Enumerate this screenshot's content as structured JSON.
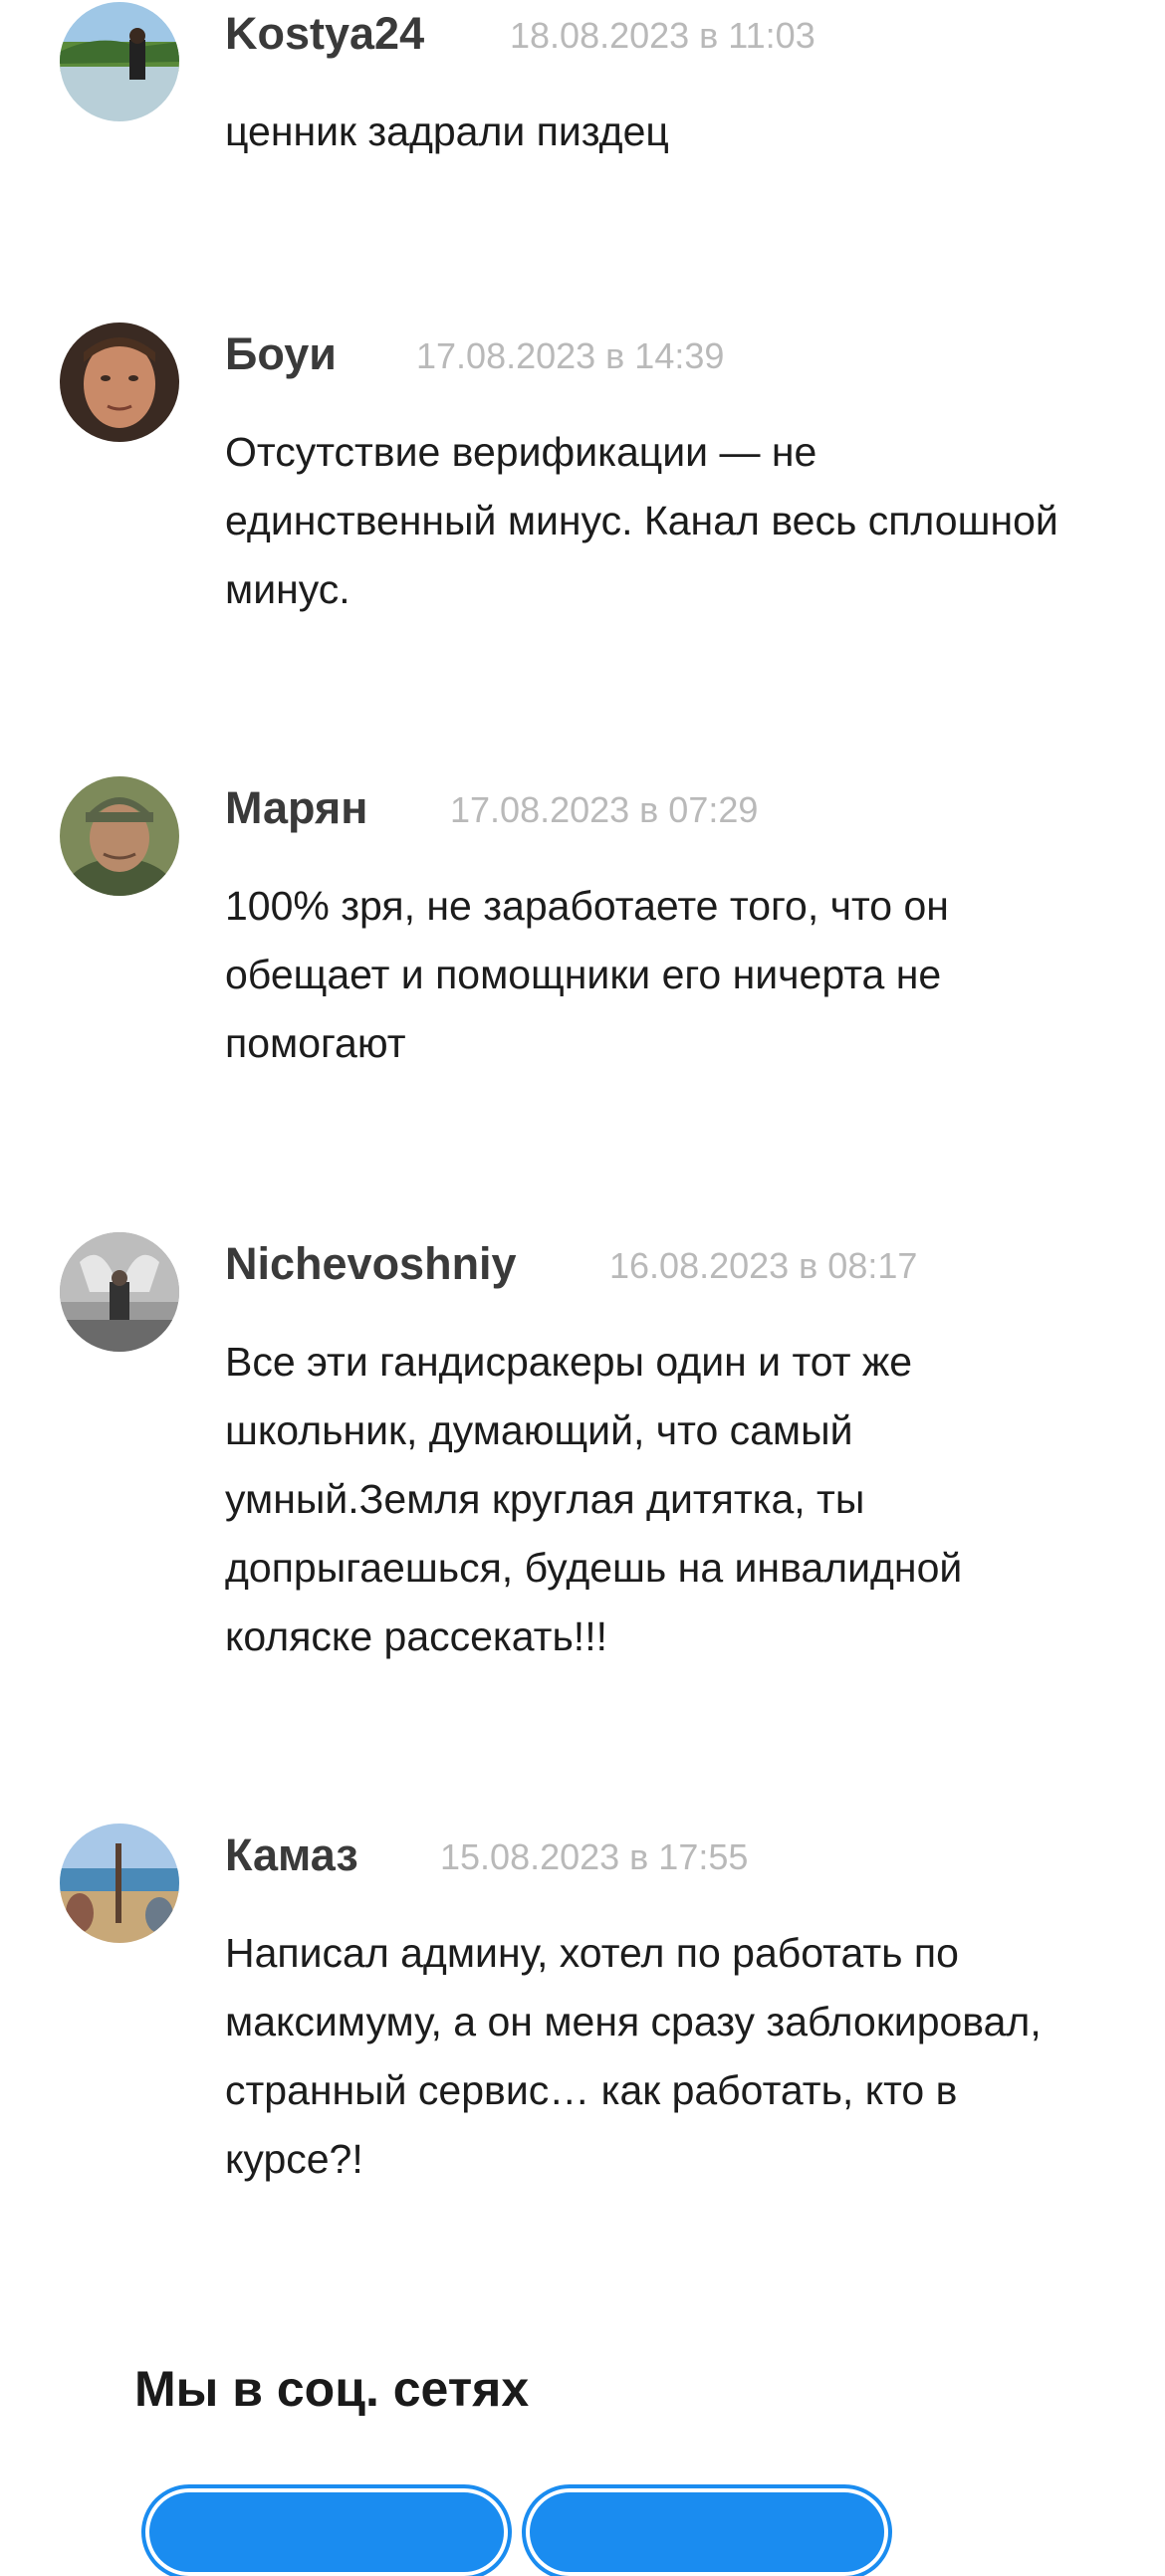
{
  "comments": [
    {
      "author": "Kostya24",
      "date": "18.08.2023 в 11:03",
      "text": "ценник задрали пиздец"
    },
    {
      "author": "Боуи",
      "date": "17.08.2023 в 14:39",
      "text": "Отсутствие верификации — не единственный минус. Канал весь сплошной минус."
    },
    {
      "author": "Марян",
      "date": "17.08.2023 в 07:29",
      "text": "100% зря, не заработаете того, что он обещает и помощники его ничерта не помогают"
    },
    {
      "author": "Nichevoshniy",
      "date": "16.08.2023 в 08:17",
      "text": "Все эти гандисракеры один и тот же школьник, думающий, что самый умный.Земля круглая дитятка, ты допрыгаешься, будешь на инвалидной коляске рассекать!!!"
    },
    {
      "author": "Камаз",
      "date": "15.08.2023 в 17:55",
      "text": "Написал админу, хотел по работать по максимуму, а он меня сразу заблокировал, странный сервис… как работать, кто в курсе?!"
    }
  ],
  "social": {
    "title": "Мы в соц. сетях"
  },
  "colors": {
    "accent": "#1a8cf0",
    "date": "#b9b9b9",
    "author": "#3a3a3a"
  }
}
